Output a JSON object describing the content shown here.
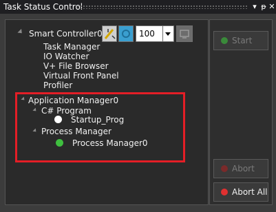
{
  "window": {
    "title": "Task Status Control",
    "pin_glyph": "▾",
    "dock_glyph": "ᵽ",
    "close_glyph": "✕"
  },
  "toolbar": {
    "controller_label": "Smart Controller0",
    "speed_value": "100"
  },
  "tree": {
    "controller_children": [
      "Task Manager",
      "IO Watcher",
      "V+ File Browser",
      "Virtual Front Panel",
      "Profiler"
    ],
    "app_manager_label": "Application Manager0",
    "csharp_label": "C# Program",
    "startup_label": "Startup_Prog",
    "process_manager_label": "Process Manager",
    "process_manager0_label": "Process Manager0"
  },
  "side_buttons": {
    "start_label": "Start",
    "abort_label": "Abort",
    "abort_all_label": "Abort All"
  },
  "colors": {
    "highlight_box": "#e41e26",
    "running_green": "#3fbf3f",
    "idle_white": "#ffffff",
    "abort_red": "#e03030"
  }
}
